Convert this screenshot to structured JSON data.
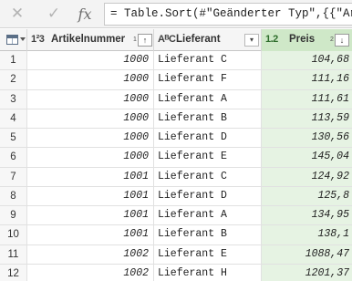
{
  "formula_bar": {
    "cancel_icon": "✕",
    "confirm_icon": "✓",
    "fx_label": "fx",
    "formula": "= Table.Sort(#\"Geänderter Typ\",{{\"Artike"
  },
  "columns": [
    {
      "type_label": "1²3",
      "name": "Artikelnummer",
      "sort_order": "1",
      "sort_icon": "↑",
      "dropdown_icon": "▾"
    },
    {
      "type_label": "AᴮC",
      "name": "Lieferant",
      "dropdown_icon": "▾"
    },
    {
      "type_label": "1.2",
      "name": "Preis",
      "sort_order": "2",
      "sort_icon": "↓",
      "dropdown_icon": "▾"
    }
  ],
  "rows": [
    {
      "idx": "1",
      "artikelnummer": "1000",
      "lieferant": "Lieferant C",
      "preis": "104,68"
    },
    {
      "idx": "2",
      "artikelnummer": "1000",
      "lieferant": "Lieferant F",
      "preis": "111,16"
    },
    {
      "idx": "3",
      "artikelnummer": "1000",
      "lieferant": "Lieferant A",
      "preis": "111,61"
    },
    {
      "idx": "4",
      "artikelnummer": "1000",
      "lieferant": "Lieferant B",
      "preis": "113,59"
    },
    {
      "idx": "5",
      "artikelnummer": "1000",
      "lieferant": "Lieferant D",
      "preis": "130,56"
    },
    {
      "idx": "6",
      "artikelnummer": "1000",
      "lieferant": "Lieferant E",
      "preis": "145,04"
    },
    {
      "idx": "7",
      "artikelnummer": "1001",
      "lieferant": "Lieferant C",
      "preis": "124,92"
    },
    {
      "idx": "8",
      "artikelnummer": "1001",
      "lieferant": "Lieferant D",
      "preis": "125,8"
    },
    {
      "idx": "9",
      "artikelnummer": "1001",
      "lieferant": "Lieferant A",
      "preis": "134,95"
    },
    {
      "idx": "10",
      "artikelnummer": "1001",
      "lieferant": "Lieferant B",
      "preis": "138,1"
    },
    {
      "idx": "11",
      "artikelnummer": "1002",
      "lieferant": "Lieferant E",
      "preis": "1088,47"
    },
    {
      "idx": "12",
      "artikelnummer": "1002",
      "lieferant": "Lieferant H",
      "preis": "1201,37"
    }
  ],
  "colors": {
    "preis_header": "#cfe8c8",
    "preis_cells": "#e6f3e3",
    "grid_line": "#e1e1e1"
  }
}
